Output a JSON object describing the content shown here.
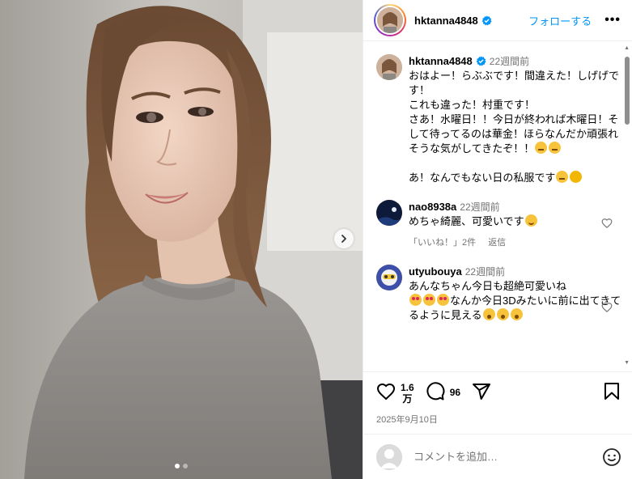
{
  "post": {
    "username": "hktanna4848",
    "follow_label": "フォローする",
    "more_label": "•••"
  },
  "caption": {
    "username": "hktanna4848",
    "time": "22週間前",
    "text_1": "おはよー！らぶぶです！間違えた！しげげです！\nこれも違った！村重です！\nさあ！水曜日！！今日が終われば木曜日！そして待ってるのは華金！ほらなんだか頑張れそうな気がしてきたぞ！！",
    "text_2": "あ！なんでもない日の私服です"
  },
  "comments": [
    {
      "username": "nao8938a",
      "time": "22週間前",
      "text": "めちゃ綺麗、可愛いです",
      "likes_label": "「いいね！」2件",
      "reply_label": "返信"
    },
    {
      "username": "utyubouya",
      "time": "22週間前",
      "text_1": "あんなちゃん今日も超絶可愛いね",
      "text_2": "なんか今日3Dみたいに前に出てきてるように見える"
    }
  ],
  "actions": {
    "likes_count_top": "1.6",
    "likes_count_bottom": "万",
    "comments_count": "96",
    "date": "2025年9月10日"
  },
  "add_comment": {
    "placeholder": "コメントを追加…"
  },
  "carousel": {
    "total": 2,
    "active": 1
  },
  "colors": {
    "accent": "#0095f6",
    "muted": "#737373",
    "verified": "#0095f6"
  },
  "icons": [
    "chevron-right-icon",
    "verified-badge-icon",
    "heart-icon",
    "comment-icon",
    "share-icon",
    "bookmark-icon",
    "emoji-icon"
  ]
}
